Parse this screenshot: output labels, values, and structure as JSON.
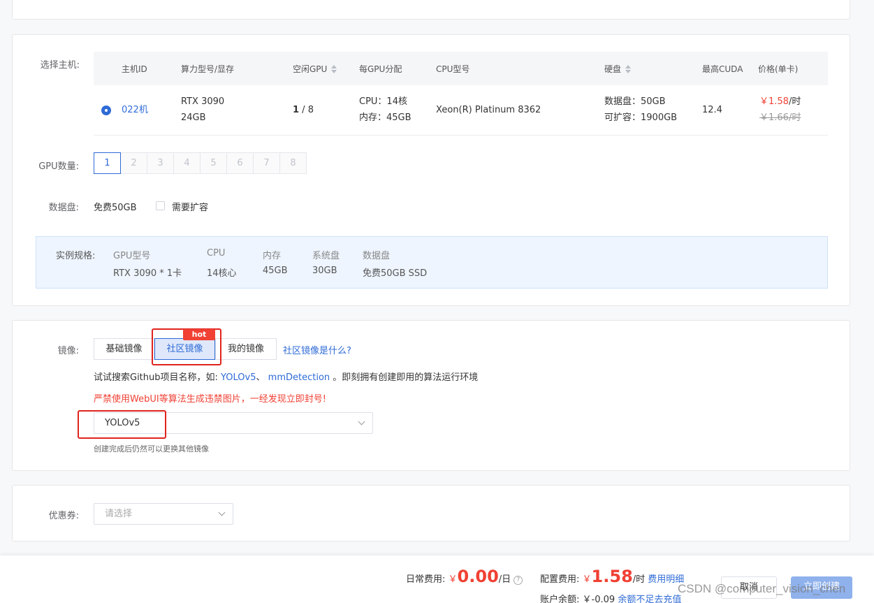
{
  "host_section": {
    "label": "选择主机:",
    "columns": {
      "host_id": "主机ID",
      "model": "算力型号/显存",
      "idle_gpu": "空闲GPU",
      "per_gpu": "每GPU分配",
      "cpu_model": "CPU型号",
      "disk": "硬盘",
      "max_cuda": "最高CUDA",
      "price": "价格(单卡)"
    },
    "row": {
      "host_id": "022机",
      "model_line1": "RTX 3090",
      "model_line2": "24GB",
      "idle_gpu_count": "1",
      "idle_gpu_total": " / 8",
      "cpu_alloc": "CPU：14核",
      "mem_alloc": "内存：45GB",
      "cpu_model": "Xeon(R) Platinum 8362",
      "disk_data": "数据盘：50GB",
      "disk_expand": "可扩容：1900GB",
      "max_cuda": "12.4",
      "price_current": "￥1.58",
      "price_unit": "/时",
      "price_original": "￥1.66/时"
    }
  },
  "gpu_count": {
    "label": "GPU数量:",
    "options": [
      "1",
      "2",
      "3",
      "4",
      "5",
      "6",
      "7",
      "8"
    ],
    "selected": "1"
  },
  "data_disk": {
    "label": "数据盘:",
    "free_text": "免费50GB",
    "expand_label": "需要扩容"
  },
  "instance_spec": {
    "label": "实例规格:",
    "items": [
      {
        "key": "GPU型号",
        "value": "RTX 3090 * 1卡"
      },
      {
        "key": "CPU",
        "value": "14核心"
      },
      {
        "key": "内存",
        "value": "45GB"
      },
      {
        "key": "系统盘",
        "value": "30GB"
      },
      {
        "key": "数据盘",
        "value": "免费50GB SSD"
      }
    ]
  },
  "image_section": {
    "label": "镜像:",
    "tabs": [
      "基础镜像",
      "社区镜像",
      "我的镜像"
    ],
    "active_tab": "社区镜像",
    "hot_badge": "hot",
    "help_link": "社区镜像是什么?",
    "hint_prefix": "试试搜索Github项目名称，如:",
    "hint_link1": "YOLOv5",
    "hint_sep": "、",
    "hint_link2": "mmDetection",
    "hint_suffix": "。即刻拥有创建即用的算法运行环境",
    "warning": "严禁使用WebUI等算法生成违禁图片，一经发现立即封号!",
    "selected_image": "YOLOv5",
    "note": "创建完成后仍然可以更换其他镜像"
  },
  "coupon": {
    "label": "优惠券:",
    "placeholder": "请选择"
  },
  "footer": {
    "daily_label": "日常费用:",
    "daily_currency": "￥",
    "daily_amount": "0.00",
    "daily_unit": "/日",
    "help_icon": "?",
    "config_label": "配置费用:",
    "config_currency": "￥",
    "config_amount": "1.58",
    "config_unit": "/时",
    "fee_detail_link": "费用明细",
    "balance_label": "账户余额:",
    "balance_value": "￥-0.09",
    "balance_warning": "余额不足去充值",
    "cancel_button": "取消",
    "create_button": "立即创建"
  },
  "watermark": "CSDN @computer_vision_chen",
  "colors": {
    "accent": "#2f6bd6",
    "price_red": "#f04134",
    "highlight_box": "#e0231d",
    "spec_bg": "#eef5fe"
  }
}
